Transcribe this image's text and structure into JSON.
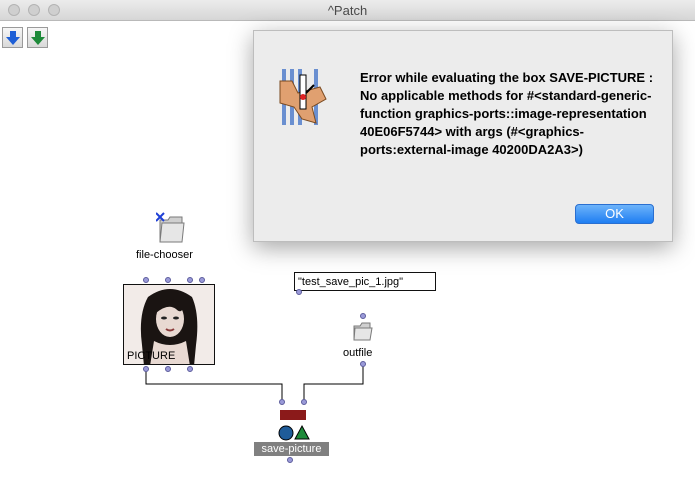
{
  "window": {
    "title": "^Patch"
  },
  "toolbar": {
    "buttons": [
      "down-arrow-blue-icon",
      "down-arrow-green-icon"
    ]
  },
  "patch": {
    "file_chooser_label": "file-chooser",
    "picture_label": "PICTURE",
    "string_value": "\"test_save_pic_1.jpg\"",
    "outfile_label": "outfile",
    "save_picture_label": "save-picture"
  },
  "dialog": {
    "message": "Error while evaluating the box SAVE-PICTURE : No applicable methods for #<standard-generic-function graphics-ports::image-representation 40E06F5744> with args (#<graphics-ports:external-image 40200DA2A3>)",
    "ok_label": "OK",
    "icon": "error-stop-hand-icon"
  },
  "colors": {
    "ok_button": "#1f7ef2",
    "inlet": "#9a9ad8",
    "save_picture_bar": "#8b1a1a",
    "save_picture_circle": "#1f5c99",
    "save_picture_triangle": "#1e8a3a"
  }
}
